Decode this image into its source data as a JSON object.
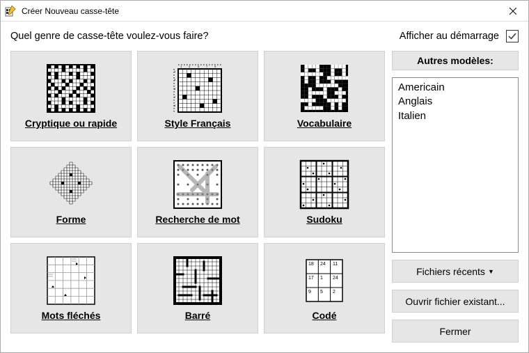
{
  "window": {
    "title": "Créer Nouveau casse-tête"
  },
  "prompt": "Quel genre de casse-tête voulez-vous faire?",
  "show_startup": {
    "label": "Afficher au démarrage",
    "checked": true
  },
  "cards": [
    {
      "label": "Cryptique ou rapide"
    },
    {
      "label": "Style Français"
    },
    {
      "label": "Vocabulaire"
    },
    {
      "label": "Forme"
    },
    {
      "label": "Recherche de mot"
    },
    {
      "label": "Sudoku"
    },
    {
      "label": "Mots fléchés"
    },
    {
      "label": "Barré"
    },
    {
      "label": "Codé"
    }
  ],
  "other_models": {
    "header": "Autres modèles:",
    "items": [
      "Americain",
      "Anglais",
      "Italien"
    ]
  },
  "buttons": {
    "recent": "Fichiers récents",
    "open": "Ouvrir fichier existant...",
    "close": "Fermer"
  }
}
